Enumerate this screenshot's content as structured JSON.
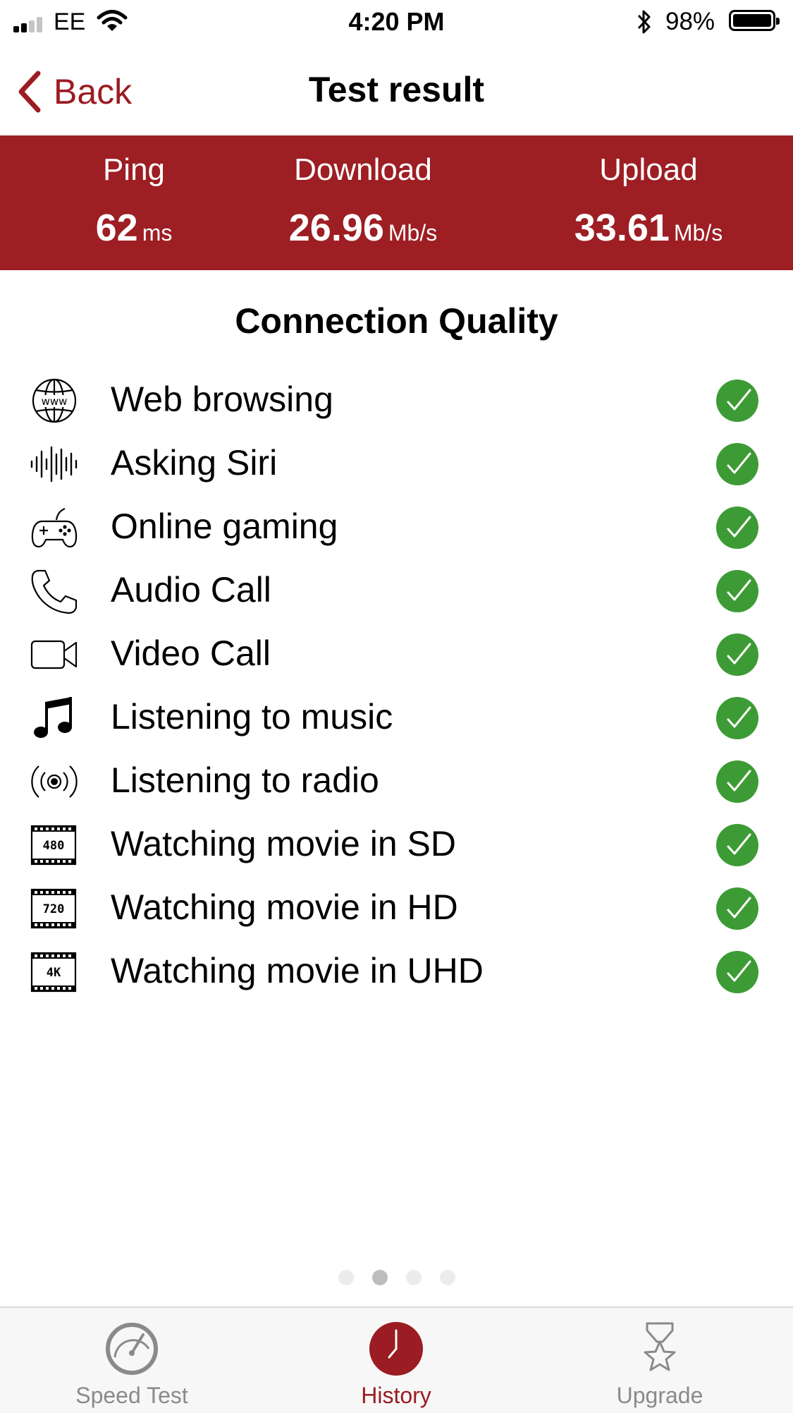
{
  "status_bar": {
    "carrier": "EE",
    "time": "4:20 PM",
    "battery": "98%"
  },
  "nav": {
    "back_label": "Back",
    "title": "Test result"
  },
  "results": {
    "ping": {
      "label": "Ping",
      "value": "62",
      "unit": "ms"
    },
    "download": {
      "label": "Download",
      "value": "26.96",
      "unit": "Mb/s"
    },
    "upload": {
      "label": "Upload",
      "value": "33.61",
      "unit": "Mb/s"
    },
    "accent_color": "#9d1e23"
  },
  "quality": {
    "title": "Connection Quality",
    "items": [
      {
        "label": "Web browsing",
        "icon": "globe-www-icon",
        "status": "ok"
      },
      {
        "label": "Asking Siri",
        "icon": "sound-wave-icon",
        "status": "ok"
      },
      {
        "label": "Online gaming",
        "icon": "gamepad-icon",
        "status": "ok"
      },
      {
        "label": "Audio Call",
        "icon": "phone-icon",
        "status": "ok"
      },
      {
        "label": "Video Call",
        "icon": "video-camera-icon",
        "status": "ok"
      },
      {
        "label": "Listening to music",
        "icon": "music-note-icon",
        "status": "ok"
      },
      {
        "label": "Listening to radio",
        "icon": "radio-broadcast-icon",
        "status": "ok"
      },
      {
        "label": "Watching movie in SD",
        "icon": "film-480-icon",
        "badge": "480",
        "status": "ok"
      },
      {
        "label": "Watching movie in HD",
        "icon": "film-720-icon",
        "badge": "720",
        "status": "ok"
      },
      {
        "label": "Watching movie in UHD",
        "icon": "film-4k-icon",
        "badge": "4K",
        "status": "ok"
      }
    ],
    "ok_color": "#3d9b35"
  },
  "pager": {
    "count": 4,
    "active_index": 1
  },
  "tabbar": {
    "tabs": [
      {
        "label": "Speed Test",
        "icon": "speedometer-icon",
        "active": false
      },
      {
        "label": "History",
        "icon": "clock-icon",
        "active": true
      },
      {
        "label": "Upgrade",
        "icon": "star-award-icon",
        "active": false
      }
    ]
  }
}
